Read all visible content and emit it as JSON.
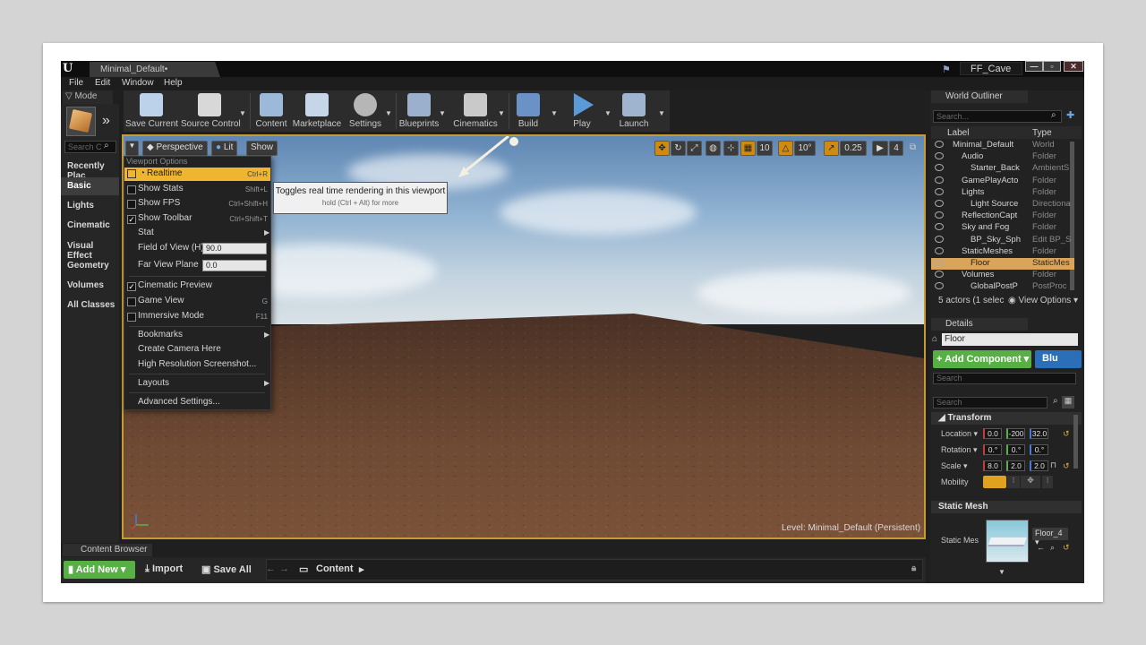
{
  "window": {
    "doc_tab": "Minimal_Default•",
    "project_name": "FF_Cave",
    "min": "—",
    "max": "▫",
    "close": "✕"
  },
  "menu": [
    "File",
    "Edit",
    "Window",
    "Help"
  ],
  "modes": {
    "tab": "Mode",
    "search_placeholder": "Search C",
    "categories": [
      "Recently Plac",
      "Basic",
      "Lights",
      "Cinematic",
      "Visual Effect",
      "Geometry",
      "Volumes",
      "All Classes"
    ],
    "active": "Basic"
  },
  "toolbar": [
    {
      "label": "Save Current",
      "icon": "save-icon",
      "color": "#bcd2ea"
    },
    {
      "label": "Source Control",
      "icon": "source-control-icon",
      "color": "#d8d8d8"
    },
    {
      "label": "Content",
      "icon": "content-icon",
      "color": "#9cb9d9"
    },
    {
      "label": "Marketplace",
      "icon": "marketplace-icon",
      "color": "#c7d5e8"
    },
    {
      "label": "Settings",
      "icon": "settings-icon",
      "color": "#b6b6b6"
    },
    {
      "label": "Blueprints",
      "icon": "blueprints-icon",
      "color": "#9bb0cc"
    },
    {
      "label": "Cinematics",
      "icon": "cinematics-icon",
      "color": "#c9c9c9"
    },
    {
      "label": "Build",
      "icon": "build-icon",
      "color": "#6b92c7"
    },
    {
      "label": "Play",
      "icon": "play-icon",
      "color": "#5b9ad8"
    },
    {
      "label": "Launch",
      "icon": "launch-icon",
      "color": "#9fb4cf"
    }
  ],
  "viewport": {
    "perspective": "Perspective",
    "lit": "Lit",
    "show": "Show",
    "grid_snap": "10",
    "rot_snap": "10°",
    "scale_snap": "0.25",
    "cam_speed": "4",
    "level": "Level:  Minimal_Default (Persistent)"
  },
  "viewport_options": {
    "header": "Viewport Options",
    "realtime": {
      "label": "Realtime",
      "shortcut": "Ctrl+R"
    },
    "show_stats": {
      "label": "Show Stats",
      "shortcut": "Shift+L"
    },
    "show_fps": {
      "label": "Show FPS",
      "shortcut": "Ctrl+Shift+H"
    },
    "show_toolbar": {
      "label": "Show Toolbar",
      "shortcut": "Ctrl+Shift+T"
    },
    "stat": "Stat",
    "fov": {
      "label": "Field of View (H)",
      "value": "90.0"
    },
    "far": {
      "label": "Far View Plane",
      "value": "0.0"
    },
    "cinematic_preview": "Cinematic Preview",
    "game_view": {
      "label": "Game View",
      "shortcut": "G"
    },
    "immersive": {
      "label": "Immersive Mode",
      "shortcut": "F11"
    },
    "bookmarks": "Bookmarks",
    "create_camera": "Create Camera Here",
    "hires": "High Resolution Screenshot...",
    "layouts": "Layouts",
    "advanced": "Advanced Settings..."
  },
  "tooltip": {
    "title": "Toggles real time rendering in this viewport",
    "hint": "hold (Ctrl + Alt) for more"
  },
  "content_browser": {
    "tab": "Content Browser",
    "add_new": "Add New",
    "import": "Import",
    "save_all": "Save All",
    "path": "Content"
  },
  "world_outliner": {
    "tab": "World Outliner",
    "search_placeholder": "Search...",
    "col_label": "Label",
    "col_type": "Type",
    "rows": [
      {
        "label": "Minimal_Default",
        "type": "World",
        "indent": 0
      },
      {
        "label": "Audio",
        "type": "Folder",
        "indent": 1
      },
      {
        "label": "Starter_Back",
        "type": "AmbientS",
        "indent": 2
      },
      {
        "label": "GamePlayActo",
        "type": "Folder",
        "indent": 1
      },
      {
        "label": "Lights",
        "type": "Folder",
        "indent": 1
      },
      {
        "label": "Light Source",
        "type": "Directiona",
        "indent": 2
      },
      {
        "label": "ReflectionCapt",
        "type": "Folder",
        "indent": 1
      },
      {
        "label": "Sky and Fog",
        "type": "Folder",
        "indent": 1
      },
      {
        "label": "BP_Sky_Sph",
        "type": "Edit BP_S",
        "indent": 2
      },
      {
        "label": "StaticMeshes",
        "type": "Folder",
        "indent": 1
      },
      {
        "label": "Floor",
        "type": "StaticMes",
        "indent": 2
      },
      {
        "label": "Volumes",
        "type": "Folder",
        "indent": 1
      },
      {
        "label": "GlobalPostP",
        "type": "PostProc",
        "indent": 2
      }
    ],
    "footer": "5 actors (1 selec",
    "view_options": "View Options"
  },
  "details": {
    "tab": "Details",
    "name": "Floor",
    "add_component": "+ Add Component",
    "blueprint": "Blu",
    "search_placeholder": "Search",
    "transform": "Transform",
    "location_label": "Location",
    "location": [
      "0.0",
      "-200",
      "32.0"
    ],
    "rotation_label": "Rotation",
    "rotation": [
      "0.°",
      "0.°",
      "0.°"
    ],
    "scale_label": "Scale",
    "scale": [
      "8.0",
      "2.0",
      "2.0"
    ],
    "mobility_label": "Mobility",
    "static_mesh_section": "Static Mesh",
    "static_mesh_label": "Static Mes",
    "mesh_name": "Floor_4"
  }
}
